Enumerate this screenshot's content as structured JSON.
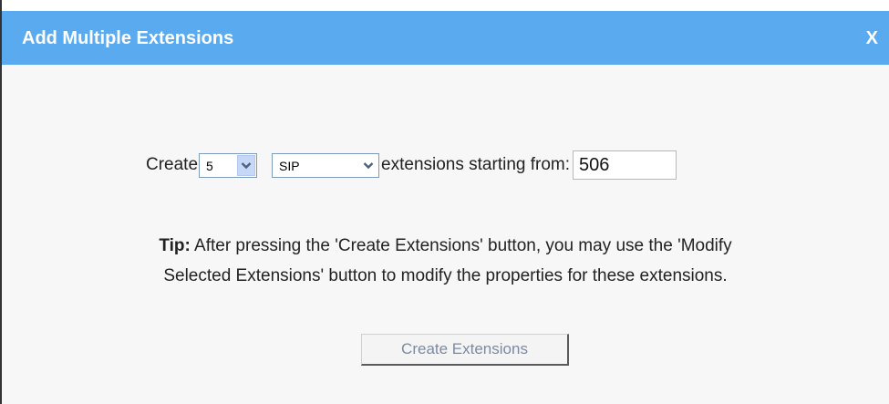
{
  "dialog": {
    "title": "Add Multiple Extensions",
    "close_label": "X"
  },
  "form": {
    "create_label": "Create",
    "count_select": {
      "value": "5"
    },
    "type_select": {
      "value": "SIP"
    },
    "starting_label": "extensions starting from:",
    "start_input": {
      "value": "506"
    }
  },
  "tip": {
    "bold": "Tip:",
    "line1_rest": " After pressing the 'Create Extensions' button, you may use the 'Modify",
    "line2": "Selected Extensions' button to modify the properties for these extensions."
  },
  "actions": {
    "create_button_label": "Create Extensions"
  },
  "icons": {
    "dropdown": "chevron-down-icon"
  }
}
